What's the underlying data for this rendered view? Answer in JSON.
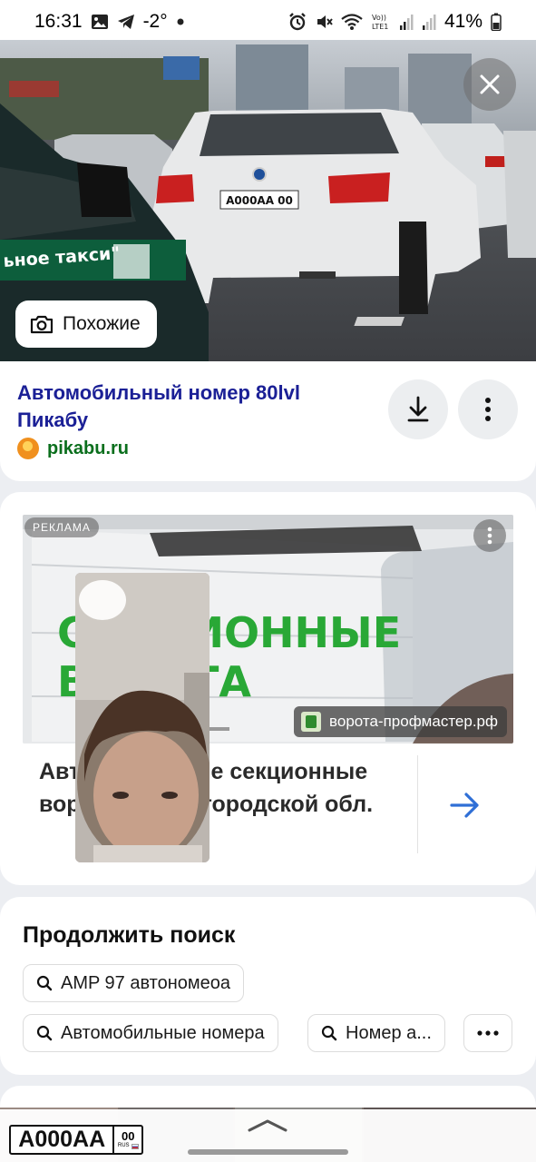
{
  "status_bar": {
    "time": "16:31",
    "temperature": "-2°",
    "battery": "41%",
    "icons": [
      "gallery-icon",
      "telegram-icon",
      "dot-icon",
      "alarm-icon",
      "mute-icon",
      "wifi-icon",
      "volte-icon",
      "signal-icon",
      "signal-icon-2",
      "battery-icon"
    ]
  },
  "hero": {
    "similar_label": "Похожие"
  },
  "result": {
    "title": "Автомобильный номер 80lvl Пикабу",
    "source": "pikabu.ru"
  },
  "ad": {
    "badge": "РЕКЛАМА",
    "domain": "ворота-профмастер.рф",
    "image_text_line1": "СЕКЦИОННЫЕ",
    "image_text_line2": "ВОРОТА",
    "text": "Автоматические секционные ворота в Нижегородской обл."
  },
  "continue_search": {
    "title": "Продолжить поиск",
    "chips": [
      "AMP 97 автономеоа",
      "Автомобильные номера",
      "Номер а..."
    ]
  },
  "plate": {
    "main": "А000АА",
    "region": "00",
    "country": "RUS"
  },
  "colors": {
    "title_blue": "#1b2096",
    "source_green": "#0b6f1d",
    "arrow_blue": "#2f6fd6"
  }
}
